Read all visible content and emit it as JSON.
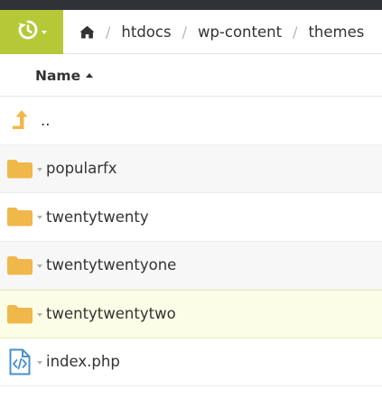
{
  "toolbar": {
    "history_icon": "history-icon",
    "home_icon": "home-icon",
    "breadcrumbs": [
      "htdocs",
      "wp-content",
      "themes"
    ],
    "separator": "/"
  },
  "list": {
    "sort_column": "Name",
    "sort_direction": "ascending",
    "parent_label": "..",
    "items": [
      {
        "name": "popularfx",
        "type": "folder"
      },
      {
        "name": "twentytwenty",
        "type": "folder"
      },
      {
        "name": "twentytwentyone",
        "type": "folder"
      },
      {
        "name": "twentytwentytwo",
        "type": "folder",
        "selected": true
      },
      {
        "name": "index.php",
        "type": "file-code"
      }
    ]
  },
  "colors": {
    "accent": "#b5c838",
    "folder": "#f0b74a",
    "up_arrow": "#f0b74a",
    "topbar": "#2f3337",
    "selected_row": "#fcfde6"
  }
}
